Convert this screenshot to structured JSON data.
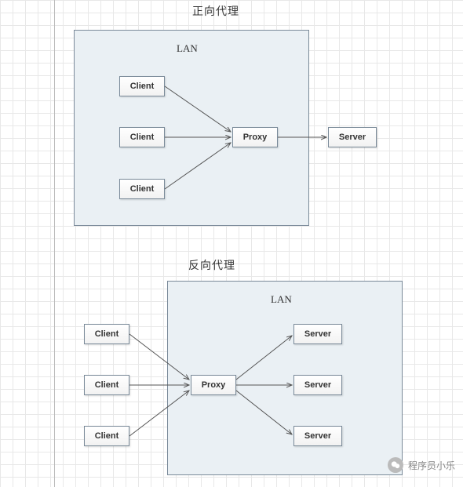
{
  "diagram1": {
    "title": "正向代理",
    "lan_label": "LAN",
    "nodes": {
      "client1": "Client",
      "client2": "Client",
      "client3": "Client",
      "proxy": "Proxy",
      "server": "Server"
    }
  },
  "diagram2": {
    "title": "反向代理",
    "lan_label": "LAN",
    "nodes": {
      "client1": "Client",
      "client2": "Client",
      "client3": "Client",
      "proxy": "Proxy",
      "server1": "Server",
      "server2": "Server",
      "server3": "Server"
    }
  },
  "watermark": {
    "text": "程序员小乐"
  }
}
